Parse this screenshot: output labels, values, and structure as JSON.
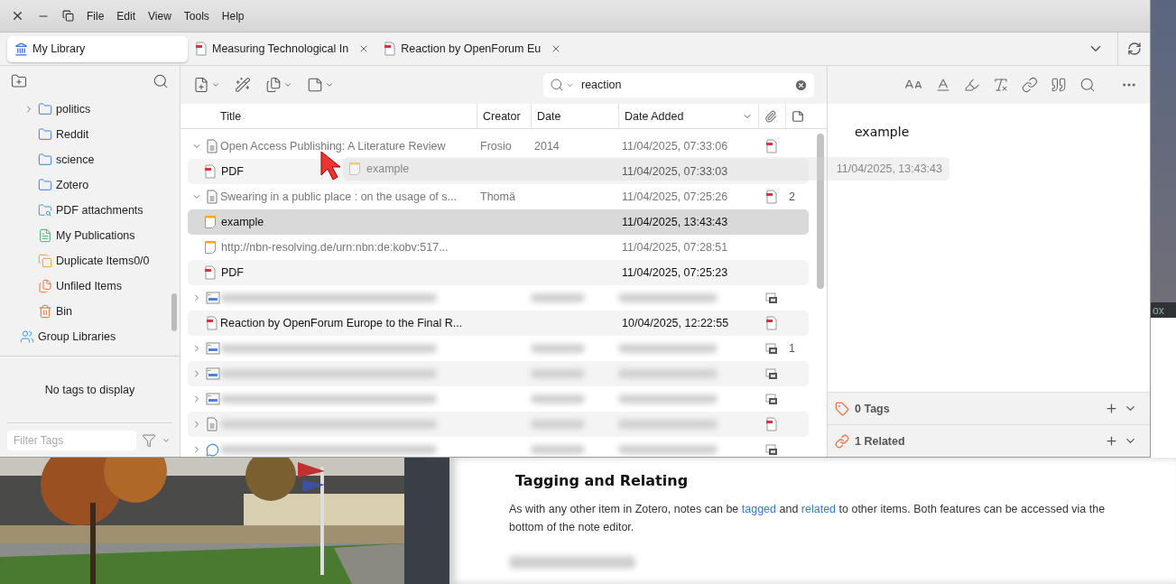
{
  "window": {
    "menu": [
      "File",
      "Edit",
      "View",
      "Tools",
      "Help"
    ]
  },
  "tabs": [
    {
      "label": "My Library",
      "selected": true,
      "kind": "library"
    },
    {
      "label": "Measuring Technological In",
      "selected": false,
      "kind": "pdf"
    },
    {
      "label": "Reaction by OpenForum Eu",
      "selected": false,
      "kind": "pdf"
    }
  ],
  "collections": [
    {
      "label": "politics",
      "kind": "folder",
      "expanded": false
    },
    {
      "label": "Reddit",
      "kind": "folder"
    },
    {
      "label": "science",
      "kind": "folder"
    },
    {
      "label": "Zotero",
      "kind": "folder"
    },
    {
      "label": "PDF attachments",
      "kind": "search"
    },
    {
      "label": "My Publications",
      "kind": "publications"
    },
    {
      "label": "Duplicate Items0/0",
      "kind": "duplicates"
    },
    {
      "label": "Unfiled Items",
      "kind": "unfiled"
    },
    {
      "label": "Bin",
      "kind": "trash"
    },
    {
      "label": "Group Libraries",
      "kind": "group"
    }
  ],
  "tags_pane": {
    "message": "No tags to display",
    "filter_placeholder": "Filter Tags"
  },
  "search": {
    "value": "reaction"
  },
  "columns": [
    {
      "label": "Title",
      "sorted": false
    },
    {
      "label": "Creator",
      "sorted": false
    },
    {
      "label": "Date",
      "sorted": false
    },
    {
      "label": "Date Added",
      "sorted": true
    }
  ],
  "rows": [
    {
      "kind": "document",
      "blurred": false,
      "expanded": true,
      "title": "Open Access Publishing: A Literature Review",
      "creator": "Frosio",
      "date": "2014",
      "date_added": "11/04/2025, 07:33:06",
      "attachment": {
        "kind": "pdf"
      },
      "dimmed": true,
      "selected": false,
      "children": [
        {
          "kind": "pdf",
          "title": "PDF",
          "date_added": "11/04/2025, 07:33:03",
          "dimmed": false,
          "selected": false
        }
      ]
    },
    {
      "kind": "document",
      "blurred": false,
      "expanded": true,
      "title": "Swearing in a public place : on the usage of s...",
      "creator": "Thomä",
      "date_added": "11/04/2025, 07:25:26",
      "attachment": {
        "kind": "pdf"
      },
      "notes": "2",
      "dimmed": true,
      "selected": false,
      "children": [
        {
          "kind": "note",
          "title": "example",
          "date_added": "11/04/2025, 13:43:43",
          "dimmed": false,
          "selected": true
        },
        {
          "kind": "note",
          "title": "http://nbn-resolving.de/urn:nbn:de:kobv:517...",
          "date_added": "11/04/2025, 07:28:51",
          "dimmed": true,
          "selected": false
        },
        {
          "kind": "pdf",
          "title": "PDF",
          "date_added": "11/04/2025, 07:25:23",
          "dimmed": false,
          "selected": false
        }
      ]
    },
    {
      "kind": "webpage",
      "blurred": true,
      "expanded": false,
      "attachment": {
        "kind": "snapshot"
      }
    },
    {
      "kind": "pdf",
      "blurred": false,
      "title": "Reaction by OpenForum Europe to the Final R...",
      "date_added": "10/04/2025, 12:22:55",
      "attachment": {
        "kind": "pdf"
      },
      "dimmed": false,
      "selected": false
    },
    {
      "kind": "webpage",
      "blurred": true,
      "expanded": false,
      "attachment": {
        "kind": "snapshot"
      },
      "notes": "1"
    },
    {
      "kind": "webpage",
      "blurred": true,
      "expanded": false,
      "attachment": {
        "kind": "snapshot"
      }
    },
    {
      "kind": "webpage",
      "blurred": true,
      "expanded": false,
      "attachment": {
        "kind": "snapshot"
      }
    },
    {
      "kind": "document",
      "blurred": true,
      "expanded": false,
      "attachment": {
        "kind": "pdf"
      }
    },
    {
      "kind": "interview",
      "blurred": true,
      "expanded": false,
      "attachment": {
        "kind": "snapshot"
      }
    }
  ],
  "drag_ghost": {
    "title": "example",
    "date_added": "11/04/2025, 13:43:43"
  },
  "note": {
    "text": "example"
  },
  "note_sections": [
    {
      "label": "0 Tags",
      "kind": "tags"
    },
    {
      "label": "1 Related",
      "kind": "related"
    }
  ],
  "background": {
    "side_label": "ox",
    "heading": "Tagging and Relating",
    "paragraph": [
      {
        "kind": "text",
        "text": "As with any other item in Zotero, notes can be "
      },
      {
        "kind": "link",
        "text": "tagged"
      },
      {
        "kind": "text",
        "text": " and "
      },
      {
        "kind": "link",
        "text": "related"
      },
      {
        "kind": "text",
        "text": " to other items. Both features can be accessed via the bottom of the note editor."
      }
    ]
  }
}
